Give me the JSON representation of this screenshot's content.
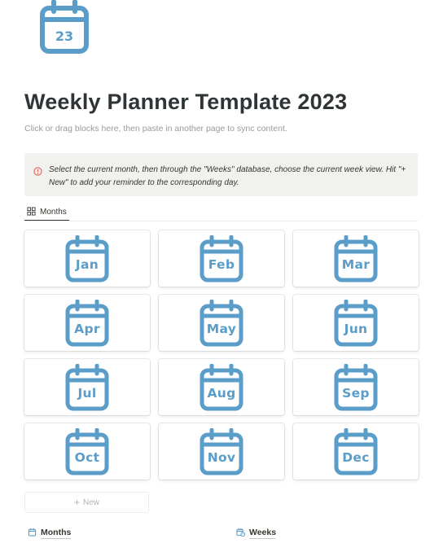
{
  "page": {
    "icon": "calendar-23-icon",
    "icon_number": "23",
    "title": "Weekly Planner Template 2023",
    "subtitle": "Click or drag blocks here, then paste in another page to sync content."
  },
  "callout": {
    "icon": "info-circle-icon",
    "text": "Select the current month, then through the \"Weeks\" database, choose the current week view. Hit \"+ New\" to add your reminder to the corresponding day."
  },
  "view_tab": {
    "icon": "gallery-grid-icon",
    "label": "Months"
  },
  "months": [
    {
      "label": "Jan"
    },
    {
      "label": "Feb"
    },
    {
      "label": "Mar"
    },
    {
      "label": "Apr"
    },
    {
      "label": "May"
    },
    {
      "label": "Jun"
    },
    {
      "label": "Jul"
    },
    {
      "label": "Aug"
    },
    {
      "label": "Sep"
    },
    {
      "label": "Oct"
    },
    {
      "label": "Nov"
    },
    {
      "label": "Dec"
    }
  ],
  "new_button": {
    "label": "New",
    "plus": "+"
  },
  "links": [
    {
      "label": "Months",
      "icon": "calendar-icon"
    },
    {
      "label": "Weeks",
      "icon": "calendar-clock-icon"
    }
  ],
  "colors": {
    "accent_blue": "#5b9dc9",
    "callout_bg": "#f1f1ef",
    "callout_icon": "#e16259"
  }
}
